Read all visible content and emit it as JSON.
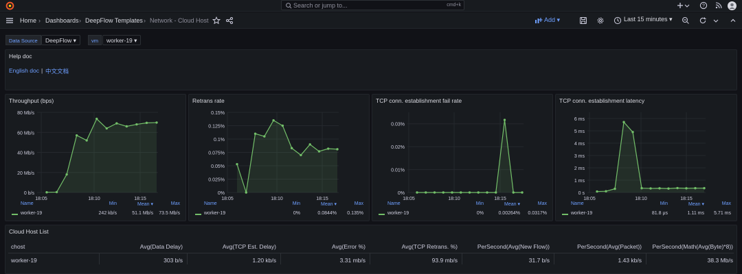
{
  "topbar": {
    "search_placeholder": "Search or jump to...",
    "search_shortcut": "cmd+k",
    "icons": [
      "grafana-logo-icon",
      "plus-icon",
      "help-icon",
      "rss-icon",
      "user-avatar-icon"
    ]
  },
  "navbar": {
    "home": "Home",
    "dashboards": "Dashboards",
    "folder": "DeepFlow Templates",
    "current": "Network - Cloud Host",
    "add_label": "Add",
    "time_range": "Last 15 minutes"
  },
  "variables": [
    {
      "label": "Data Source",
      "value": "DeepFlow"
    },
    {
      "label": "vm",
      "value": "worker-19"
    }
  ],
  "help_panel": {
    "title": "Help doc",
    "link_en": "English doc",
    "separator": "|",
    "link_cn": "中文文档"
  },
  "legend_headers": {
    "name": "Name",
    "min": "Min",
    "mean": "Mean",
    "max": "Max"
  },
  "series_color": "#73bf69",
  "panels": [
    {
      "title": "Throughput (bps)",
      "series_name": "worker-19",
      "min": "242 kb/s",
      "mean": "51.1 Mb/s",
      "max": "73.5 Mb/s",
      "chart_data": {
        "type": "area",
        "yticks": [
          "0 b/s",
          "20 Mb/s",
          "40 Mb/s",
          "60 Mb/s",
          "80 Mb/s"
        ],
        "ylim": [
          0,
          80
        ],
        "xticks": [
          "18:05",
          "18:10",
          "18:15"
        ],
        "x": [
          0,
          1,
          2,
          3,
          4,
          5,
          6,
          7,
          8,
          9,
          10,
          11
        ],
        "values": [
          0.2,
          0.4,
          18,
          57,
          52,
          73.5,
          64,
          69,
          66,
          68,
          69.5,
          69.8
        ]
      }
    },
    {
      "title": "Retrans rate",
      "series_name": "worker-19",
      "min": "0%",
      "mean": "0.0844%",
      "max": "0.135%",
      "chart_data": {
        "type": "area",
        "yticks": [
          "0%",
          "0.025%",
          "0.05%",
          "0.075%",
          "0.1%",
          "0.125%",
          "0.15%"
        ],
        "ylim": [
          0,
          0.15
        ],
        "xticks": [
          "18:05",
          "18:10",
          "18:15"
        ],
        "x": [
          0,
          1,
          2,
          3,
          4,
          5,
          6,
          7,
          8,
          9,
          10,
          11
        ],
        "values": [
          0.053,
          0,
          0.11,
          0.105,
          0.135,
          0.125,
          0.083,
          0.07,
          0.09,
          0.077,
          0.082,
          0.081
        ]
      }
    },
    {
      "title": "TCP conn. establishment fail rate",
      "series_name": "worker-19",
      "min": "0%",
      "mean": "0.00264%",
      "max": "0.0317%",
      "chart_data": {
        "type": "area",
        "yticks": [
          "0%",
          "0.01%",
          "0.02%",
          "0.03%"
        ],
        "ylim": [
          0,
          0.035
        ],
        "xticks": [
          "18:05",
          "18:10",
          "18:15"
        ],
        "x": [
          0,
          1,
          2,
          3,
          4,
          5,
          6,
          7,
          8,
          9,
          10,
          11,
          12
        ],
        "values": [
          0,
          0,
          0,
          0,
          0,
          0,
          0,
          0,
          0,
          0,
          0.0317,
          0,
          0
        ]
      }
    },
    {
      "title": "TCP conn. establishment latency",
      "series_name": "worker-19",
      "min": "81.8 μs",
      "mean": "1.11 ms",
      "max": "5.71 ms",
      "chart_data": {
        "type": "area",
        "yticks": [
          "0 s",
          "1 ms",
          "2 ms",
          "3 ms",
          "4 ms",
          "5 ms",
          "6 ms"
        ],
        "ylim": [
          0,
          6.5
        ],
        "xticks": [
          "18:05",
          "18:10",
          "18:15"
        ],
        "x": [
          0,
          1,
          2,
          3,
          4,
          5,
          6,
          7,
          8,
          9,
          10,
          11,
          12
        ],
        "values": [
          0.08,
          0.1,
          0.3,
          5.71,
          4.9,
          0.35,
          0.33,
          0.34,
          0.32,
          0.36,
          0.34,
          0.35,
          0.35
        ]
      }
    }
  ],
  "host_table": {
    "title": "Cloud Host List",
    "columns": [
      "chost",
      "Avg(Data Delay)",
      "Avg(TCP Est. Delay)",
      "Avg(Error %)",
      "Avg(TCP Retrans. %)",
      "PerSecond(Avg(New Flow))",
      "PerSecond(Avg(Packet))",
      "PerSecond(Math(Avg(Byte)*8))"
    ],
    "rows": [
      [
        "worker-19",
        "303 b/s",
        "1.20 kb/s",
        "3.31 mb/s",
        "93.9 mb/s",
        "31.7 b/s",
        "1.43 kb/s",
        "38.3 Mb/s"
      ]
    ]
  }
}
